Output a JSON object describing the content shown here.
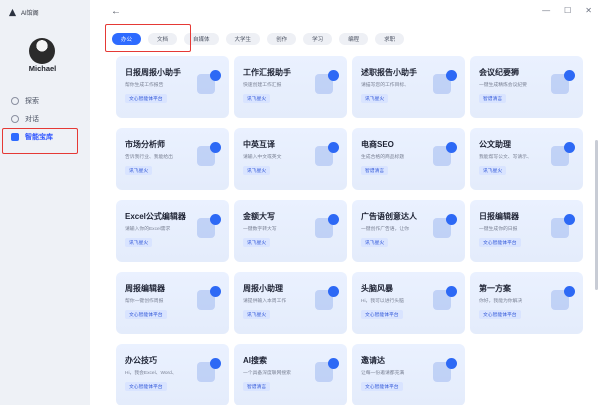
{
  "app": {
    "title": "AI馆阁",
    "username": "Michael"
  },
  "sidebar": {
    "items": [
      {
        "label": "探索",
        "icon": "compass-icon"
      },
      {
        "label": "对话",
        "icon": "chat-icon"
      },
      {
        "label": "智能宝库",
        "icon": "library-icon",
        "active": true
      }
    ]
  },
  "window": {
    "minimize": "—",
    "maximize": "☐",
    "close": "✕",
    "back": "←"
  },
  "tabs": [
    {
      "label": "办公",
      "active": true
    },
    {
      "label": "文档"
    },
    {
      "label": "自媒体"
    },
    {
      "label": "大学生"
    },
    {
      "label": "创作"
    },
    {
      "label": "学习"
    },
    {
      "label": "编程"
    },
    {
      "label": "求职"
    }
  ],
  "cards": [
    {
      "title": "日报周报小助手",
      "desc": "帮你生成工作报告",
      "tag": "文心智能体平台"
    },
    {
      "title": "工作汇报助手",
      "desc": "快速创建工作汇报",
      "tag": "讯飞星火"
    },
    {
      "title": "述职报告小助手",
      "desc": "请描写您的工作目标、",
      "tag": "讯飞星火"
    },
    {
      "title": "会议纪要狮",
      "desc": "一键生成精炼会议纪要",
      "tag": "智谱清言"
    },
    {
      "title": "市场分析师",
      "desc": "告诉我行业、我能给出",
      "tag": "讯飞星火"
    },
    {
      "title": "中英互译",
      "desc": "请输入中文或英文",
      "tag": "讯飞星火"
    },
    {
      "title": "电商SEO",
      "desc": "生成合格的商品标题",
      "tag": "智谱清言"
    },
    {
      "title": "公文助理",
      "desc": "我能帮写公文、写请示、",
      "tag": "讯飞星火"
    },
    {
      "title": "Excel公式编辑器",
      "desc": "请输入你的Excel需求",
      "tag": "讯飞星火"
    },
    {
      "title": "金额大写",
      "desc": "一键数字转大写",
      "tag": "讯飞星火"
    },
    {
      "title": "广告语创意达人",
      "desc": "一键创作广告语，让你",
      "tag": "讯飞星火"
    },
    {
      "title": "日报编辑器",
      "desc": "一键生成你的日报",
      "tag": "文心智能体平台"
    },
    {
      "title": "周报编辑器",
      "desc": "帮你一键创作周报",
      "tag": "文心智能体平台"
    },
    {
      "title": "周报小助理",
      "desc": "请提供输入本周工作",
      "tag": "讯飞星火"
    },
    {
      "title": "头脑风暴",
      "desc": "Hi，我可以进行头脑",
      "tag": "文心智能体平台"
    },
    {
      "title": "第一方案",
      "desc": "你好，我能为你解决",
      "tag": "文心智能体平台"
    },
    {
      "title": "办公技巧",
      "desc": "Hi，我会Excel、Word、",
      "tag": "文心智能体平台"
    },
    {
      "title": "AI搜索",
      "desc": "一个具备深度联网搜索",
      "tag": "智谱清言"
    },
    {
      "title": "邀请达",
      "desc": "让每一份邀请都充满",
      "tag": "文心智能体平台"
    }
  ],
  "colors": {
    "accent": "#2e6bff",
    "highlight": "#e53935",
    "card_bg": "#e8effd",
    "sidebar_bg": "#eef1f6"
  }
}
